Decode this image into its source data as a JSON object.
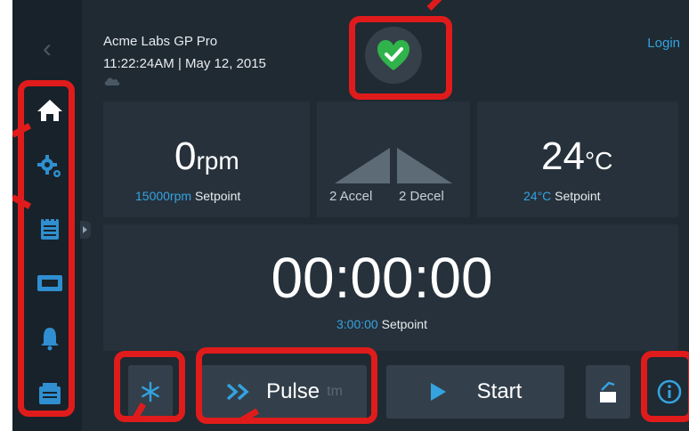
{
  "header": {
    "title": "Acme Labs GP Pro",
    "datetime": "11:22:24AM | May 12, 2015",
    "login_label": "Login"
  },
  "sidebar": {
    "items": [
      {
        "name": "home",
        "icon": "home-icon"
      },
      {
        "name": "settings",
        "icon": "gears-icon"
      },
      {
        "name": "programs",
        "icon": "notepad-icon"
      },
      {
        "name": "rotor",
        "icon": "rotor-icon"
      },
      {
        "name": "alarms",
        "icon": "bell-icon"
      },
      {
        "name": "logs",
        "icon": "folder-icon"
      }
    ]
  },
  "status": {
    "icon": "heart-check-icon",
    "color": "#2fb34a"
  },
  "speed": {
    "value": "0",
    "unit": "rpm",
    "setpoint_value": "15000rpm",
    "setpoint_label": "Setpoint"
  },
  "accel": {
    "accel_label": "2 Accel",
    "decel_label": "2 Decel"
  },
  "temperature": {
    "value": "24",
    "unit": "°C",
    "setpoint_value": "24°C",
    "setpoint_label": "Setpoint"
  },
  "timer": {
    "value": "00:00:00",
    "setpoint_value": "3:00:00",
    "setpoint_label": "Setpoint"
  },
  "controls": {
    "pulse_label": "Pulse",
    "pulse_suffix": "tm",
    "start_label": "Start"
  },
  "colors": {
    "accent": "#34a3e0",
    "highlight": "#e01b1b",
    "background": "#1f2a33"
  }
}
